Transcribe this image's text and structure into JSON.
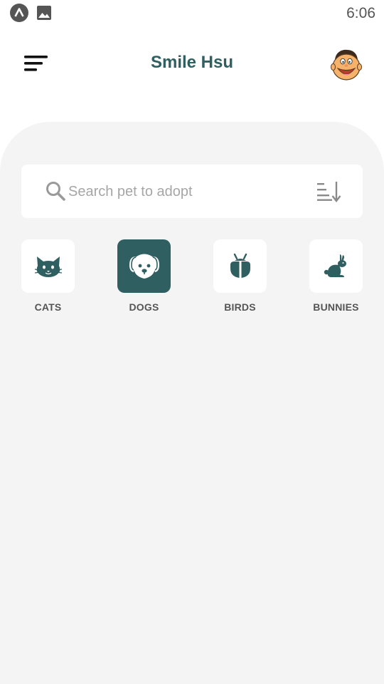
{
  "status_bar": {
    "time": "6:06",
    "icons": [
      "app-notification-icon",
      "image-notification-icon"
    ]
  },
  "header": {
    "title": "Smile Hsu",
    "menu_icon": "menu-icon",
    "avatar": "user-avatar"
  },
  "search": {
    "placeholder": "Search pet to adopt",
    "value": "",
    "sort_icon": "sort-icon"
  },
  "categories": [
    {
      "label": "CATS",
      "icon": "cat-icon",
      "selected": false
    },
    {
      "label": "DOGS",
      "icon": "dog-icon",
      "selected": true
    },
    {
      "label": "BIRDS",
      "icon": "bird-icon",
      "selected": false
    },
    {
      "label": "BUNNIES",
      "icon": "bunny-icon",
      "selected": false
    }
  ],
  "colors": {
    "accent": "#2f5f60",
    "panel_background": "#f4f4f4",
    "label_text": "#555555",
    "placeholder_text": "#a6a6a6"
  }
}
